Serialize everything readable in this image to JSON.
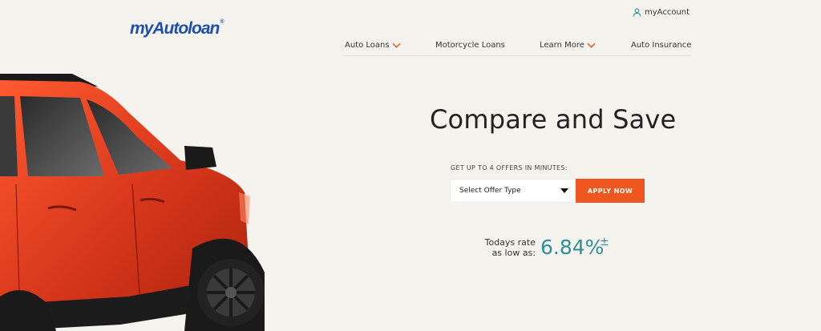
{
  "brand": {
    "name": "myAutoloan",
    "registered": "®",
    "color": "#1f4fa8"
  },
  "header": {
    "account_label": "myAccount"
  },
  "nav": {
    "items": [
      {
        "label": "Auto Loans",
        "has_dropdown": true
      },
      {
        "label": "Motorcycle Loans",
        "has_dropdown": false
      },
      {
        "label": "Learn More",
        "has_dropdown": true
      },
      {
        "label": "Auto Insurance",
        "has_dropdown": false
      }
    ]
  },
  "hero": {
    "headline": "Compare and Save",
    "offers_label": "GET UP TO 4 OFFERS IN MINUTES:",
    "select": {
      "value": "Select Offer Type"
    },
    "apply_label": "APPLY NOW",
    "rate": {
      "label_line1": "Todays rate",
      "label_line2": "as low as:",
      "value": "6.84%",
      "marker": "±"
    }
  },
  "colors": {
    "accent": "#f0561f",
    "teal": "#2e8f99",
    "background": "#f4f3ee",
    "car_body": "#d9381c"
  },
  "icons": {
    "account": "user-icon",
    "dropdown": "chevron-down-icon",
    "select": "caret-down-icon"
  }
}
